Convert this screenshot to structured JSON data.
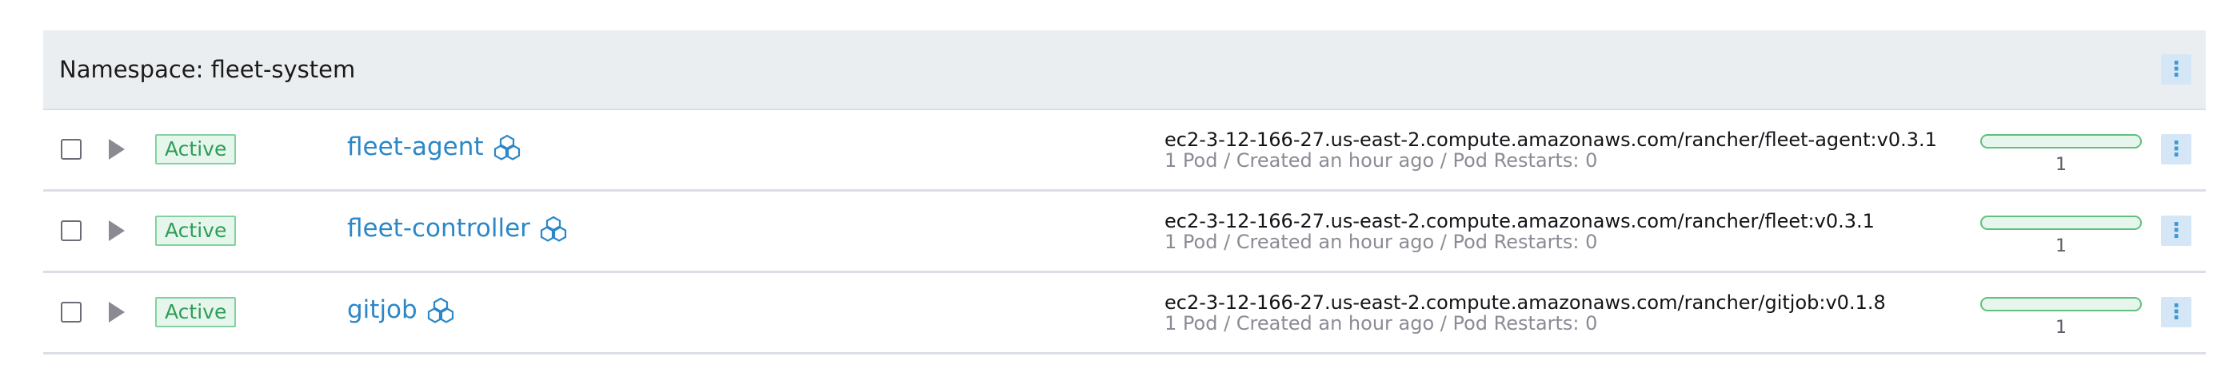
{
  "group": {
    "title": "Namespace: fleet-system",
    "menu_icon": "kebab-icon"
  },
  "rows": [
    {
      "state": "Active",
      "name": "fleet-agent",
      "image": "ec2-3-12-166-27.us-east-2.compute.amazonaws.com/rancher/fleet-agent:v0.3.1",
      "detail": "1 Pod / Created an hour ago / Pod Restarts: 0",
      "scale_count": "1",
      "scale_fraction": 1.0
    },
    {
      "state": "Active",
      "name": "fleet-controller",
      "image": "ec2-3-12-166-27.us-east-2.compute.amazonaws.com/rancher/fleet:v0.3.1",
      "detail": "1 Pod / Created an hour ago / Pod Restarts: 0",
      "scale_count": "1",
      "scale_fraction": 1.0
    },
    {
      "state": "Active",
      "name": "gitjob",
      "image": "ec2-3-12-166-27.us-east-2.compute.amazonaws.com/rancher/gitjob:v0.1.8",
      "detail": "1 Pod / Created an hour ago / Pod Restarts: 0",
      "scale_count": "1",
      "scale_fraction": 1.0
    }
  ],
  "colors": {
    "link": "#2b87c8",
    "active_green": "#2e9e55",
    "header_bg": "#ebeef0",
    "kebab_bg": "#d5e6f7"
  },
  "icons": {
    "workload_icon": "deployment-icon",
    "expand_icon": "triangle-right-icon"
  }
}
